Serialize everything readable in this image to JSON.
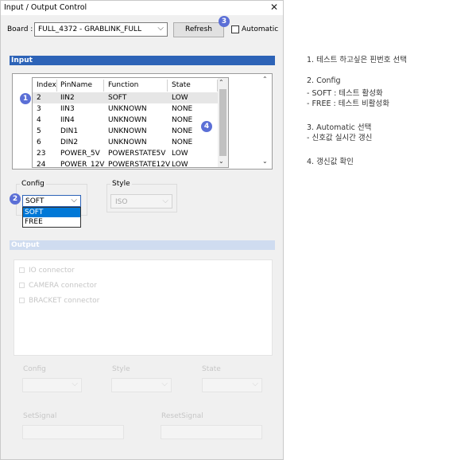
{
  "window": {
    "title": "Input / Output Control",
    "close_glyph": "✕"
  },
  "board": {
    "label": "Board :",
    "value": "FULL_4372  -  GRABLINK_FULL"
  },
  "refresh_label": "Refresh",
  "automatic_label": "Automatic",
  "input_section": "Input",
  "table": {
    "headers": [
      "Index",
      "PinName",
      "Function",
      "State"
    ],
    "rows": [
      [
        "2",
        "IIN2",
        "SOFT",
        "LOW"
      ],
      [
        "3",
        "IIN3",
        "UNKNOWN",
        "NONE"
      ],
      [
        "4",
        "IIN4",
        "UNKNOWN",
        "NONE"
      ],
      [
        "5",
        "DIN1",
        "UNKNOWN",
        "NONE"
      ],
      [
        "6",
        "DIN2",
        "UNKNOWN",
        "NONE"
      ],
      [
        "23",
        "POWER_5V",
        "POWERSTATE5V",
        "LOW"
      ],
      [
        "24",
        "POWER_12V",
        "POWERSTATE12V",
        "LOW"
      ]
    ]
  },
  "config": {
    "group_label": "Config",
    "value": "SOFT",
    "options": [
      "SOFT",
      "FREE"
    ]
  },
  "style": {
    "group_label": "Style",
    "value": "ISO"
  },
  "output_section": "Output",
  "output_tree": [
    "IO connector",
    "CAMERA connector",
    "BRACKET connector"
  ],
  "output_fields": {
    "config": "Config",
    "style": "Style",
    "state": "State",
    "set_signal": "SetSignal",
    "reset_signal": "ResetSignal"
  },
  "badges": [
    "1",
    "2",
    "3",
    "4"
  ],
  "notes": [
    "1. 테스트 하고싶은 핀번호 선택",
    "2. Config",
    " - SOFT : 테스트 활성화",
    " - FREE : 테스트 비활성화",
    "3. Automatic 선택",
    " - 신호값 실시간 갱신",
    "4. 갱신값 확인"
  ],
  "colors": {
    "accent": "#2d63b7",
    "badge": "#5b6fd6",
    "selection": "#0078d7"
  }
}
